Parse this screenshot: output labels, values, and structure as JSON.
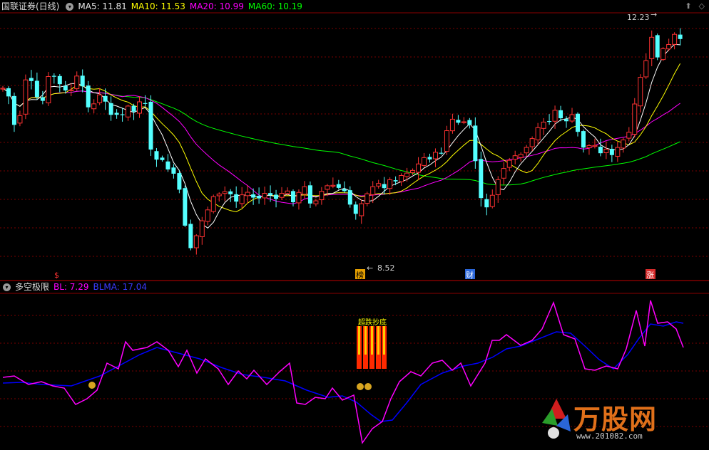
{
  "header": {
    "title": "国联证券(日线)",
    "ma5": "MA5: 11.81",
    "ma10": "MA10: 11.53",
    "ma20": "MA20: 10.99",
    "ma60": "MA60: 10.19",
    "collapse_icon": "chevron-down",
    "right_icons": [
      "up-arrow",
      "diamond"
    ]
  },
  "indicator": {
    "name": "多空极限",
    "bl": "BL: 7.29",
    "blma": "BLMA: 17.04",
    "signal_text": "超跌抄底"
  },
  "annotations": {
    "high_label": "12.23",
    "low_label": "8.52",
    "marker_1": "$",
    "marker_2": "榜",
    "marker_3": "财",
    "marker_4": "涨"
  },
  "watermark": {
    "brand": "万股网",
    "url": "www.201082.com"
  },
  "colors": {
    "up": "#ff3232",
    "down": "#54ffff",
    "ma5": "#ffffff",
    "ma10": "#ffff00",
    "ma20": "#ff00ff",
    "ma60": "#00ff00",
    "bl": "#ff00ff",
    "blma": "#0000ff",
    "grid": "#7a0000"
  }
}
